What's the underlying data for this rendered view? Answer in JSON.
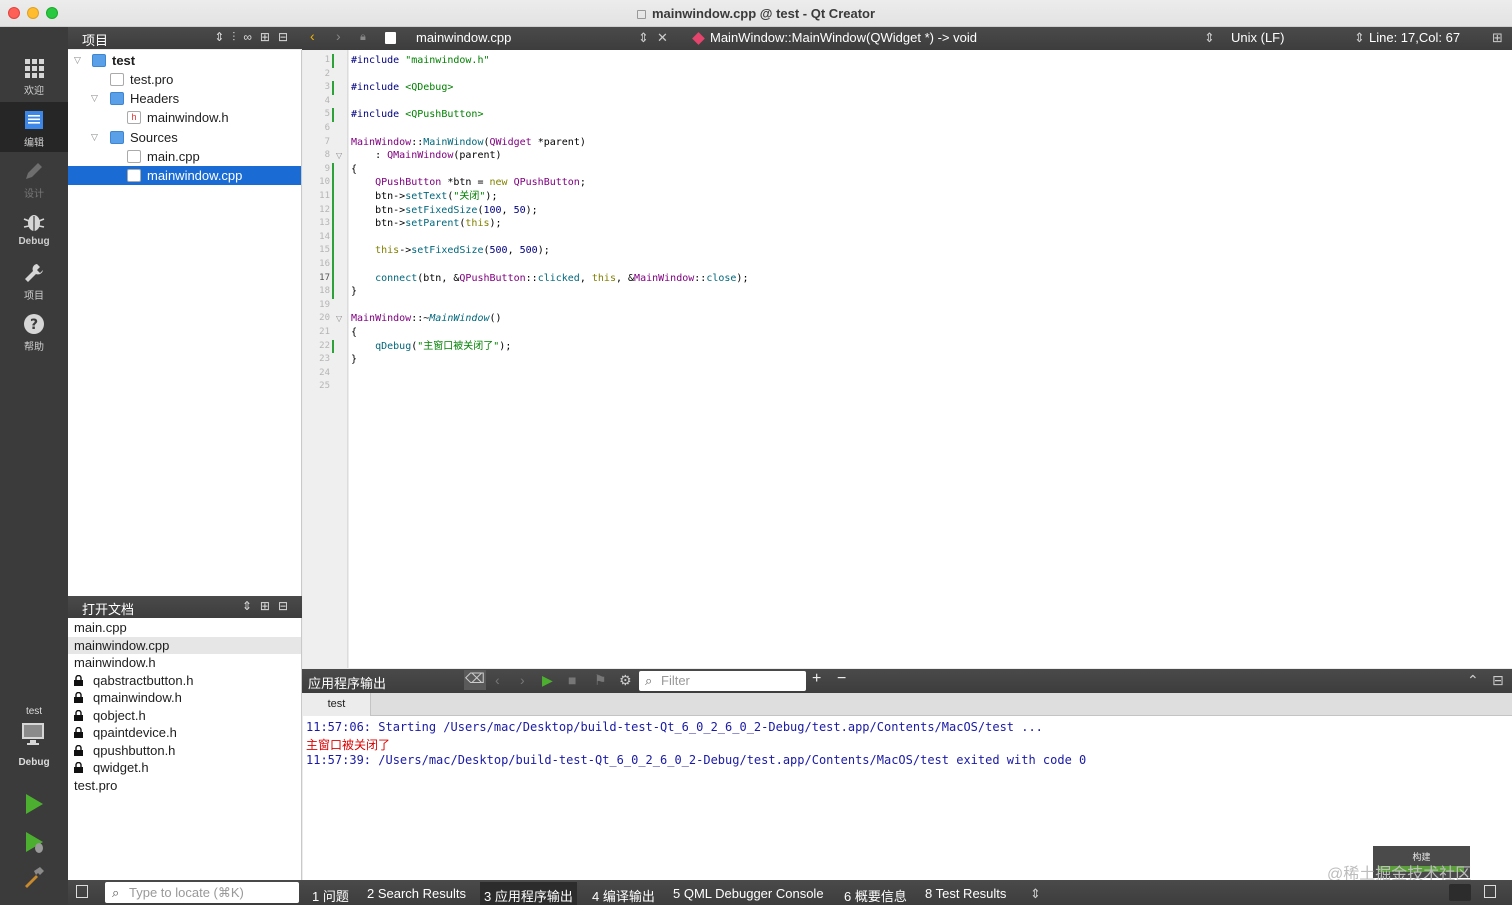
{
  "window": {
    "title": "mainwindow.cpp @ test - Qt Creator"
  },
  "modes": [
    {
      "label": "欢迎",
      "icon": "grid-icon"
    },
    {
      "label": "编辑",
      "icon": "edit-icon"
    },
    {
      "label": "设计",
      "icon": "pencil-icon"
    },
    {
      "label": "Debug",
      "icon": "bug-icon"
    },
    {
      "label": "项目",
      "icon": "wrench-icon"
    },
    {
      "label": "帮助",
      "icon": "help-icon"
    }
  ],
  "kit": {
    "project": "test",
    "config": "Debug"
  },
  "project_pane": {
    "title": "项目",
    "tree": [
      {
        "label": "test",
        "level": 0,
        "type": "project",
        "expanded": true,
        "bold": true
      },
      {
        "label": "test.pro",
        "level": 1,
        "type": "pro"
      },
      {
        "label": "Headers",
        "level": 1,
        "type": "folder",
        "expanded": true
      },
      {
        "label": "mainwindow.h",
        "level": 2,
        "type": "header"
      },
      {
        "label": "Sources",
        "level": 1,
        "type": "folder",
        "expanded": true
      },
      {
        "label": "main.cpp",
        "level": 2,
        "type": "cpp"
      },
      {
        "label": "mainwindow.cpp",
        "level": 2,
        "type": "cpp",
        "selected": true
      }
    ]
  },
  "open_docs": {
    "title": "打开文档",
    "items": [
      {
        "label": "main.cpp",
        "locked": false
      },
      {
        "label": "mainwindow.cpp",
        "locked": false,
        "current": true
      },
      {
        "label": "mainwindow.h",
        "locked": false
      },
      {
        "label": "qabstractbutton.h",
        "locked": true
      },
      {
        "label": "qmainwindow.h",
        "locked": true
      },
      {
        "label": "qobject.h",
        "locked": true
      },
      {
        "label": "qpaintdevice.h",
        "locked": true
      },
      {
        "label": "qpushbutton.h",
        "locked": true
      },
      {
        "label": "qwidget.h",
        "locked": true
      },
      {
        "label": "test.pro",
        "locked": false
      }
    ]
  },
  "editor_bar": {
    "file": "mainwindow.cpp",
    "symbol": "MainWindow::MainWindow(QWidget *) -> void",
    "line_ending": "Unix (LF)",
    "position": "Line: 17,Col: 67"
  },
  "editor": {
    "current_line": 17,
    "line_count": 25,
    "modified_lines": [
      1,
      3,
      5,
      9,
      10,
      11,
      12,
      13,
      14,
      15,
      16,
      17,
      18,
      22
    ],
    "fold_lines": [
      8,
      20
    ]
  },
  "output": {
    "title": "应用程序输出",
    "filter_placeholder": "Filter",
    "tab": "test",
    "lines": [
      {
        "text": "11:57:06: Starting /Users/mac/Desktop/build-test-Qt_6_0_2_6_0_2-Debug/test.app/Contents/MacOS/test ...",
        "kind": "info"
      },
      {
        "text": "主窗口被关闭了",
        "kind": "stdout"
      },
      {
        "text": "11:57:39: /Users/mac/Desktop/build-test-Qt_6_0_2_6_0_2-Debug/test.app/Contents/MacOS/test exited with code 0",
        "kind": "info"
      }
    ]
  },
  "bottom": {
    "locate_placeholder": "Type to locate (⌘K)",
    "tabs": [
      "1  问题",
      "2  Search Results",
      "3  应用程序输出",
      "4  编译输出",
      "5  QML Debugger Console",
      "6  概要信息",
      "8  Test Results"
    ],
    "build_label": "构建"
  },
  "watermark": "@稀土掘金技术社区",
  "colors": {
    "selection": "#1a6bd4",
    "accent": "#f5b400",
    "run": "#4caf2f"
  }
}
